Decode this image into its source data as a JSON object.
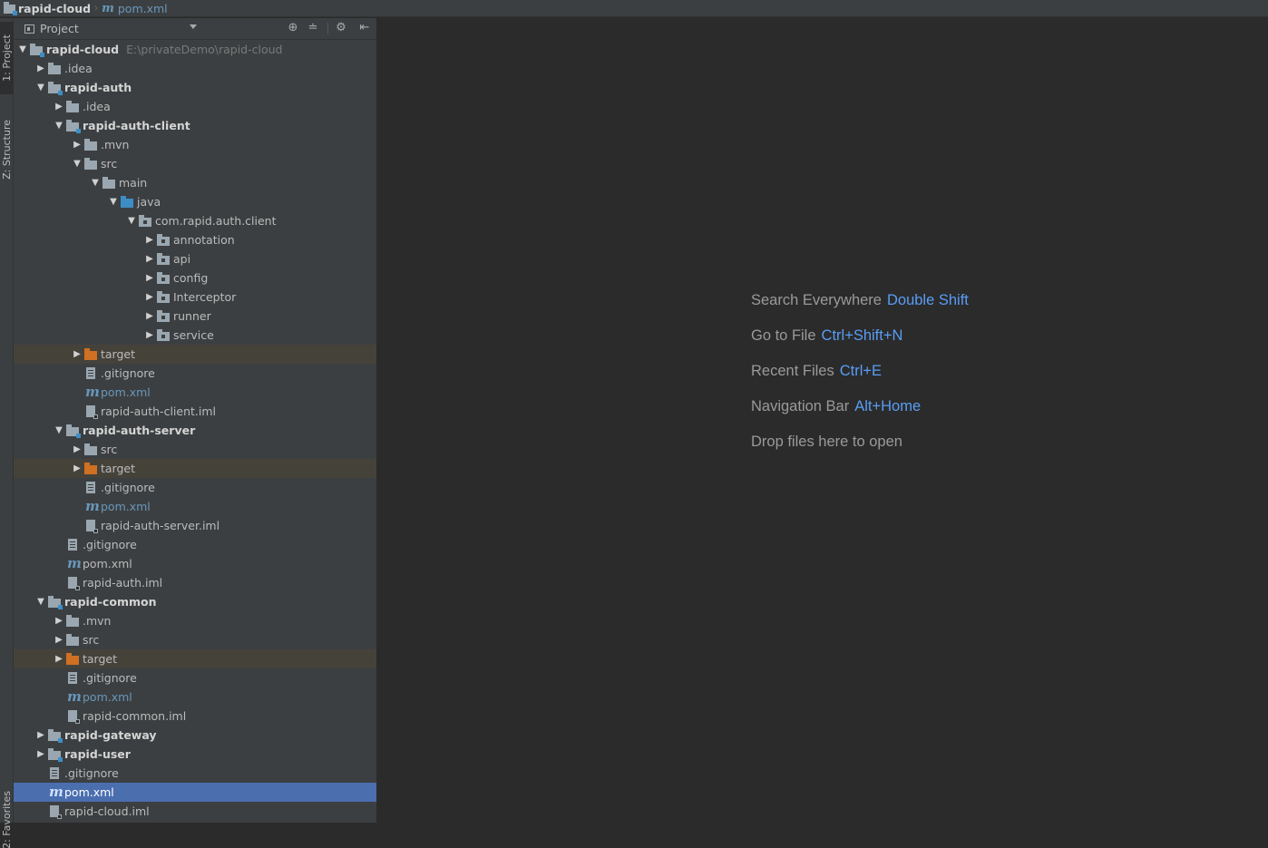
{
  "breadcrumb": {
    "project": "rapid-cloud",
    "file": "pom.xml",
    "file_icon": "m"
  },
  "toolwindows": {
    "project": "1: Project",
    "structure": "Z: Structure",
    "favorites": "2: Favorites"
  },
  "panel": {
    "title": "Project"
  },
  "tree": [
    {
      "depth": 0,
      "arrow": "down",
      "icon": "module",
      "label": "rapid-cloud",
      "bold": true,
      "path": "E:\\privateDemo\\rapid-cloud"
    },
    {
      "depth": 1,
      "arrow": "right",
      "icon": "folder",
      "label": ".idea"
    },
    {
      "depth": 1,
      "arrow": "down",
      "icon": "module",
      "label": "rapid-auth",
      "bold": true
    },
    {
      "depth": 2,
      "arrow": "right",
      "icon": "folder",
      "label": ".idea"
    },
    {
      "depth": 2,
      "arrow": "down",
      "icon": "module",
      "label": "rapid-auth-client",
      "bold": true
    },
    {
      "depth": 3,
      "arrow": "right",
      "icon": "folder",
      "label": ".mvn"
    },
    {
      "depth": 3,
      "arrow": "down",
      "icon": "folder",
      "label": "src"
    },
    {
      "depth": 4,
      "arrow": "down",
      "icon": "folder",
      "label": "main"
    },
    {
      "depth": 5,
      "arrow": "down",
      "icon": "source",
      "label": "java"
    },
    {
      "depth": 6,
      "arrow": "down",
      "icon": "package",
      "label": "com.rapid.auth.client"
    },
    {
      "depth": 7,
      "arrow": "right",
      "icon": "package",
      "label": "annotation"
    },
    {
      "depth": 7,
      "arrow": "right",
      "icon": "package",
      "label": "api"
    },
    {
      "depth": 7,
      "arrow": "right",
      "icon": "package",
      "label": "config"
    },
    {
      "depth": 7,
      "arrow": "right",
      "icon": "package",
      "label": "Interceptor"
    },
    {
      "depth": 7,
      "arrow": "right",
      "icon": "package",
      "label": "runner"
    },
    {
      "depth": 7,
      "arrow": "right",
      "icon": "package",
      "label": "service"
    },
    {
      "depth": 3,
      "arrow": "right",
      "icon": "excluded",
      "label": "target",
      "excluded": true
    },
    {
      "depth": 3,
      "arrow": "none",
      "icon": "gitignore",
      "label": ".gitignore"
    },
    {
      "depth": 3,
      "arrow": "none",
      "icon": "maven",
      "label": "pom.xml",
      "maven": true
    },
    {
      "depth": 3,
      "arrow": "none",
      "icon": "iml",
      "label": "rapid-auth-client.iml"
    },
    {
      "depth": 2,
      "arrow": "down",
      "icon": "module",
      "label": "rapid-auth-server",
      "bold": true
    },
    {
      "depth": 3,
      "arrow": "right",
      "icon": "folder",
      "label": "src"
    },
    {
      "depth": 3,
      "arrow": "right",
      "icon": "excluded",
      "label": "target",
      "excluded": true
    },
    {
      "depth": 3,
      "arrow": "none",
      "icon": "gitignore",
      "label": ".gitignore"
    },
    {
      "depth": 3,
      "arrow": "none",
      "icon": "maven",
      "label": "pom.xml",
      "maven": true
    },
    {
      "depth": 3,
      "arrow": "none",
      "icon": "iml",
      "label": "rapid-auth-server.iml"
    },
    {
      "depth": 2,
      "arrow": "none",
      "icon": "gitignore",
      "label": ".gitignore"
    },
    {
      "depth": 2,
      "arrow": "none",
      "icon": "maven",
      "label": "pom.xml"
    },
    {
      "depth": 2,
      "arrow": "none",
      "icon": "iml",
      "label": "rapid-auth.iml"
    },
    {
      "depth": 1,
      "arrow": "down",
      "icon": "module",
      "label": "rapid-common",
      "bold": true
    },
    {
      "depth": 2,
      "arrow": "right",
      "icon": "folder",
      "label": ".mvn"
    },
    {
      "depth": 2,
      "arrow": "right",
      "icon": "folder",
      "label": "src"
    },
    {
      "depth": 2,
      "arrow": "right",
      "icon": "excluded",
      "label": "target",
      "excluded": true
    },
    {
      "depth": 2,
      "arrow": "none",
      "icon": "gitignore",
      "label": ".gitignore"
    },
    {
      "depth": 2,
      "arrow": "none",
      "icon": "maven",
      "label": "pom.xml",
      "maven": true
    },
    {
      "depth": 2,
      "arrow": "none",
      "icon": "iml",
      "label": "rapid-common.iml"
    },
    {
      "depth": 1,
      "arrow": "right",
      "icon": "module",
      "label": "rapid-gateway",
      "bold": true
    },
    {
      "depth": 1,
      "arrow": "right",
      "icon": "module",
      "label": "rapid-user",
      "bold": true
    },
    {
      "depth": 1,
      "arrow": "none",
      "icon": "gitignore",
      "label": ".gitignore"
    },
    {
      "depth": 1,
      "arrow": "none",
      "icon": "maven",
      "label": "pom.xml",
      "selected": true
    },
    {
      "depth": 1,
      "arrow": "none",
      "icon": "iml",
      "label": "rapid-cloud.iml"
    }
  ],
  "editor_hints": [
    {
      "text": "Search Everywhere",
      "key": "Double Shift"
    },
    {
      "text": "Go to File",
      "key": "Ctrl+Shift+N"
    },
    {
      "text": "Recent Files",
      "key": "Ctrl+E"
    },
    {
      "text": "Navigation Bar",
      "key": "Alt+Home"
    },
    {
      "text": "Drop files here to open",
      "key": ""
    }
  ]
}
